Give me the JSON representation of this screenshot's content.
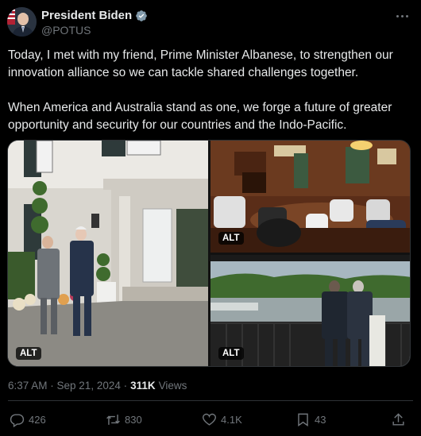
{
  "author": {
    "display_name": "President Biden",
    "handle": "@POTUS",
    "verified": true
  },
  "tweet": {
    "text": "Today, I met with my friend, Prime Minister Albanese, to strengthen our innovation alliance so we can tackle shared challenges together.\n\nWhen America and Australia stand as one, we forge a future of greater opportunity and security for our countries and the Indo-Pacific."
  },
  "media": {
    "images": [
      {
        "alt_badge": "ALT",
        "subject": "two-leaders-outside-house"
      },
      {
        "alt_badge": "ALT",
        "subject": "meeting-in-wood-paneled-room"
      },
      {
        "alt_badge": "ALT",
        "subject": "two-leaders-on-balcony-overlooking-river"
      }
    ]
  },
  "meta": {
    "timestamp": "6:37 AM · Sep 21, 2024 ·",
    "views_count": "311K",
    "views_label": "Views"
  },
  "actions": {
    "reply_count": "426",
    "repost_count": "830",
    "like_count": "4.1K",
    "bookmark_count": "43"
  },
  "colors": {
    "background": "#000000",
    "text": "#e7e9ea",
    "muted": "#71767b",
    "verified": "#1d9bf0",
    "divider": "#2f3336"
  }
}
